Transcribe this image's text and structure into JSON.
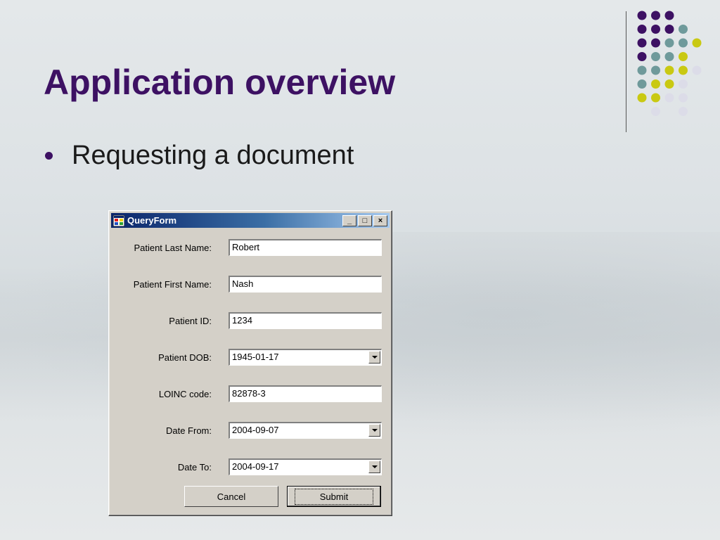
{
  "slide": {
    "title": "Application overview",
    "bullet": "Requesting a document"
  },
  "theme": {
    "title_color": "#3d1163",
    "dot_colors": [
      "#3d1163",
      "#6f9a9b",
      "#c9c912",
      "#dcdce8"
    ]
  },
  "window": {
    "title": "QueryForm",
    "controls": [
      "_",
      "□",
      "×"
    ],
    "fields": [
      {
        "label": "Patient Last Name:",
        "value": "Robert",
        "type": "text"
      },
      {
        "label": "Patient First Name:",
        "value": "Nash",
        "type": "text"
      },
      {
        "label": "Patient ID:",
        "value": "1234",
        "type": "text"
      },
      {
        "label": "Patient DOB:",
        "value": "1945-01-17",
        "type": "dropdown"
      },
      {
        "label": "LOINC code:",
        "value": "82878-3",
        "type": "text"
      },
      {
        "label": "Date From:",
        "value": "2004-09-07",
        "type": "dropdown"
      },
      {
        "label": "Date To:",
        "value": "2004-09-17",
        "type": "dropdown"
      }
    ],
    "buttons": {
      "cancel": "Cancel",
      "submit": "Submit"
    }
  }
}
